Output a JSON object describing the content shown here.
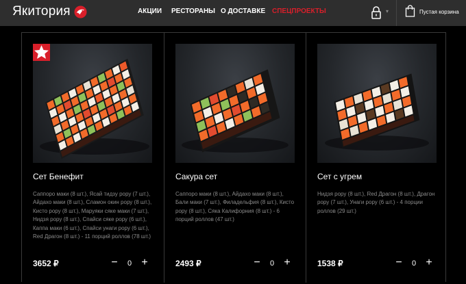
{
  "header": {
    "logo_text": "Якитория",
    "nav": [
      {
        "label": "АКЦИИ"
      },
      {
        "label": "РЕСТОРАНЫ"
      },
      {
        "label": "О ДОСТАВКЕ"
      },
      {
        "label": "СПЕЦПРОЕКТЫ"
      }
    ],
    "cart_label": "Пустая корзина"
  },
  "colors": {
    "accent": "#d91f2a",
    "header_bg": "#2e2e2e",
    "page_bg": "#000000"
  },
  "icons": {
    "logo": "yakitoriya-bird-icon",
    "account": "lock-icon",
    "account_dropdown": "chevron-down-icon",
    "cart": "shopping-bag-icon",
    "badge": "star-icon"
  },
  "products": [
    {
      "title": "Сет Бенефит",
      "description": "Саппоро маки (8 шт.), Ясай тидзу рору (7 шт.), Айдахо маки (8 шт.), Сламон окин рору (8 шт.), Кисто рору (8 шт.), Маруяки сяке маки (7 шт.), Нидзя рору (8 шт.), Спайси сяке рору (6 шт.), Каппа маки (6 шт.), Спайси унаги рору (6 шт.), Red Драгон (8 шт.) - 11 порций роллов (78 шт.)",
      "price": "3652 ₽",
      "quantity": "0",
      "minus": "−",
      "plus": "+",
      "badge": "star"
    },
    {
      "title": "Сакура сет",
      "description": "Саппоро маки (8 шт.), Айдахо маки (8 шт.), Бали маки (7 шт.), Филадельфия (8 шт.), Кисто рору (8 шт.), Сяка Калифорния (8 шт.) - 6 порций роллов (47 шт.)",
      "price": "2493 ₽",
      "quantity": "0",
      "minus": "−",
      "plus": "+"
    },
    {
      "title": "Сет с угрем",
      "description": "Нидзя рору (8 шт.), Red Драгон (8 шт.), Драгон рору (7 шт.), Унаги рору (6 шт.) - 4 порции роллов (29 шт.)",
      "price": "1538 ₽",
      "quantity": "0",
      "minus": "−",
      "plus": "+"
    }
  ]
}
